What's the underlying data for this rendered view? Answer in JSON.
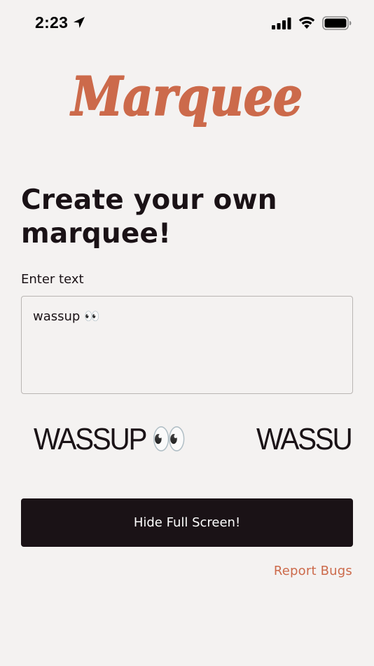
{
  "status_bar": {
    "time": "2:23",
    "icons": [
      "location-arrow-icon",
      "cellular-signal-icon",
      "wifi-icon",
      "battery-icon"
    ]
  },
  "logo": {
    "text": "Marquee",
    "color": "#cc6a4b"
  },
  "heading": "Create your own marquee!",
  "input": {
    "label": "Enter text",
    "value": "wassup 👀"
  },
  "marquee": {
    "items": [
      "WASSUP 👀",
      "WASSUP 👀"
    ]
  },
  "button": {
    "label": "Hide Full Screen!"
  },
  "report_link": "Report Bugs",
  "colors": {
    "background": "#f4f2f1",
    "accent": "#cc6a4b",
    "dark": "#1a1216"
  }
}
